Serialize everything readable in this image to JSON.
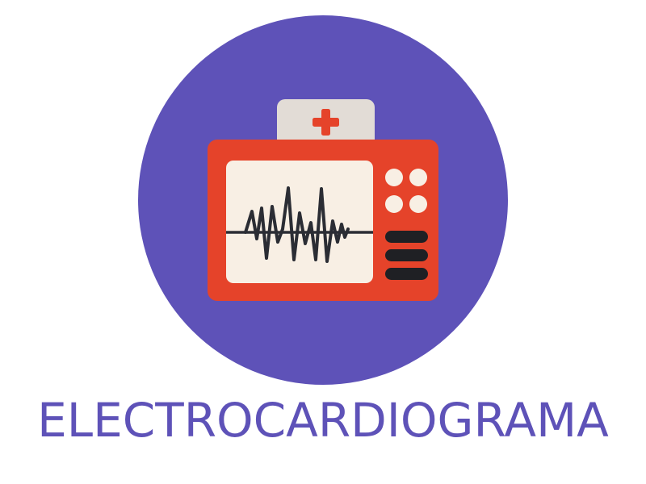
{
  "caption": {
    "text": "ELECTROCARDIOGRAMA"
  },
  "icon": {
    "name": "ecg-monitor-icon"
  },
  "colors": {
    "circle": "#5e52b8",
    "monitor_body": "#e5432a",
    "screen": "#f8efe4",
    "top_panel": "#e2dcd6",
    "cross": "#e5432a",
    "knob": "#f8efe4",
    "slot": "#1f2024",
    "wave": "#2b2d34",
    "caption": "#5e52b8"
  }
}
